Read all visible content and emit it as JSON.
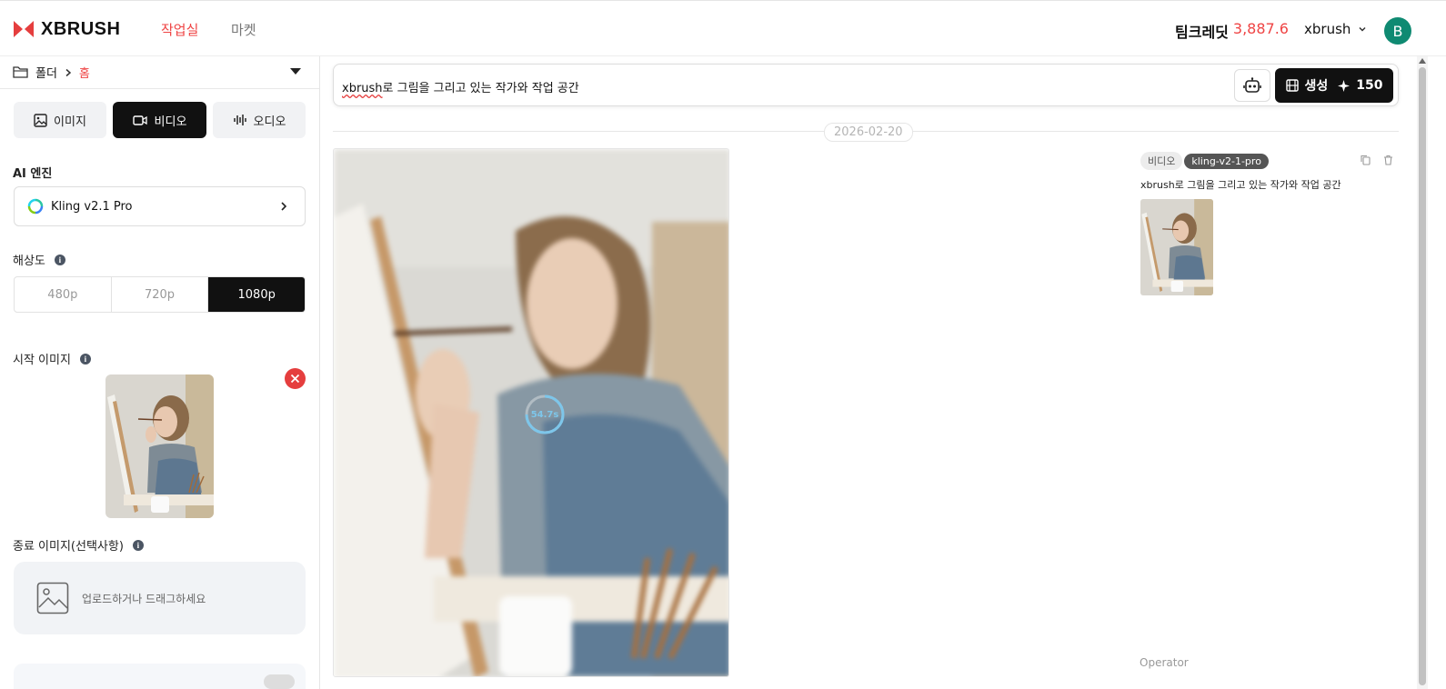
{
  "header": {
    "logo_text": "XBRUSH",
    "tabs": [
      {
        "label": "작업실",
        "active": true
      },
      {
        "label": "마켓",
        "active": false
      }
    ],
    "credits_label": "팀크레딧",
    "credits_value": "3,887.6",
    "username": "xbrush",
    "avatar_initial": "B"
  },
  "sidebar": {
    "folder_label": "폴더",
    "home_label": "홈",
    "modes": [
      {
        "label": "이미지",
        "icon": "image-icon",
        "active": false
      },
      {
        "label": "비디오",
        "icon": "video-icon",
        "active": true
      },
      {
        "label": "오디오",
        "icon": "audio-wave-icon",
        "active": false
      }
    ],
    "engine_label": "AI 엔진",
    "engine_value": "Kling v2.1 Pro",
    "resolution_label": "해상도",
    "resolutions": [
      {
        "label": "480p",
        "active": false
      },
      {
        "label": "720p",
        "active": false
      },
      {
        "label": "1080p",
        "active": true
      }
    ],
    "start_image_label": "시작 이미지",
    "end_image_label": "종료 이미지(선택사항)",
    "upload_text": "업로드하거나 드래그하세요"
  },
  "main": {
    "prompt": {
      "prefix": "xbrush",
      "rest": "로 그림을 그리고 있는 작가와 작업 공간"
    },
    "generate_label": "생성",
    "generate_cost": "150",
    "date": "2026-02-20",
    "timer": "54.7s",
    "badges": [
      "비디오",
      "kling-v2-1-pro"
    ],
    "meta_prompt": "xbrush로 그림을 그리고 있는 작가와 작업 공간",
    "operator": "Operator"
  },
  "colors": {
    "accent": "#ef4444",
    "dark": "#111111",
    "avatar": "#0f8a72",
    "remove": "#e53e3e"
  }
}
